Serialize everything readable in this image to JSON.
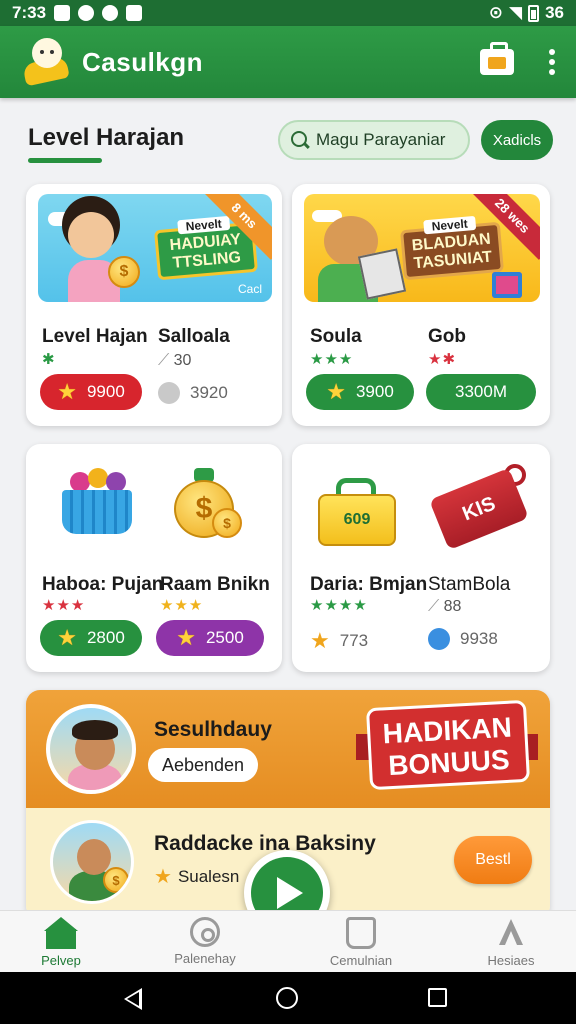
{
  "status_bar": {
    "time": "7:33",
    "right_text": "36"
  },
  "app": {
    "title": "Casulkgn"
  },
  "header": {
    "section_title": "Level Harajan",
    "search_label": "Magu Parayaniar",
    "filter_label": "Xadicls"
  },
  "cards": [
    {
      "banner": {
        "sign_tag": "Nevelt",
        "sign_text": "HADUIAY TTSLING",
        "corner": "8 ms",
        "caption": "Cacl"
      },
      "items": [
        {
          "title": "Level Hajan",
          "stars": "✱",
          "button_value": "9900"
        },
        {
          "title": "Salloala",
          "sub": "30",
          "value": "3920"
        }
      ]
    },
    {
      "banner": {
        "sign_tag": "Nevelt",
        "sign_text": "BLADUAN TASUNIAT",
        "corner": "28 wes"
      },
      "items": [
        {
          "title": "Soula",
          "stars": "★★★",
          "button_value": "3900"
        },
        {
          "title": "Gob",
          "stars": "★✱",
          "button_value": "3300M"
        }
      ]
    },
    {
      "items": [
        {
          "title": "Haboa: Pujan",
          "stars": "★★★",
          "button_value": "2800"
        },
        {
          "title": "Raam Bnikn",
          "stars": "★★★",
          "button_value": "2500"
        }
      ]
    },
    {
      "toolbox_text": "609",
      "ticket_text": "KIS",
      "items": [
        {
          "title": "Daria: Bmjan",
          "stars": "★★★★",
          "value": "773"
        },
        {
          "title": "StamBola",
          "sub": "88",
          "value": "9938"
        }
      ]
    }
  ],
  "promo": {
    "name": "Sesulhdauy",
    "chip": "Aebenden",
    "ribbon": "HADIKAN BONUUS",
    "title2": "Raddacke ina Baksiny",
    "sub2": "Sualesn",
    "best_button": "Bestl"
  },
  "bottom_nav": [
    {
      "label": "Pelvep"
    },
    {
      "label": "Palenehay"
    },
    {
      "label": "Cemulnian"
    },
    {
      "label": "Hesiaes"
    }
  ]
}
